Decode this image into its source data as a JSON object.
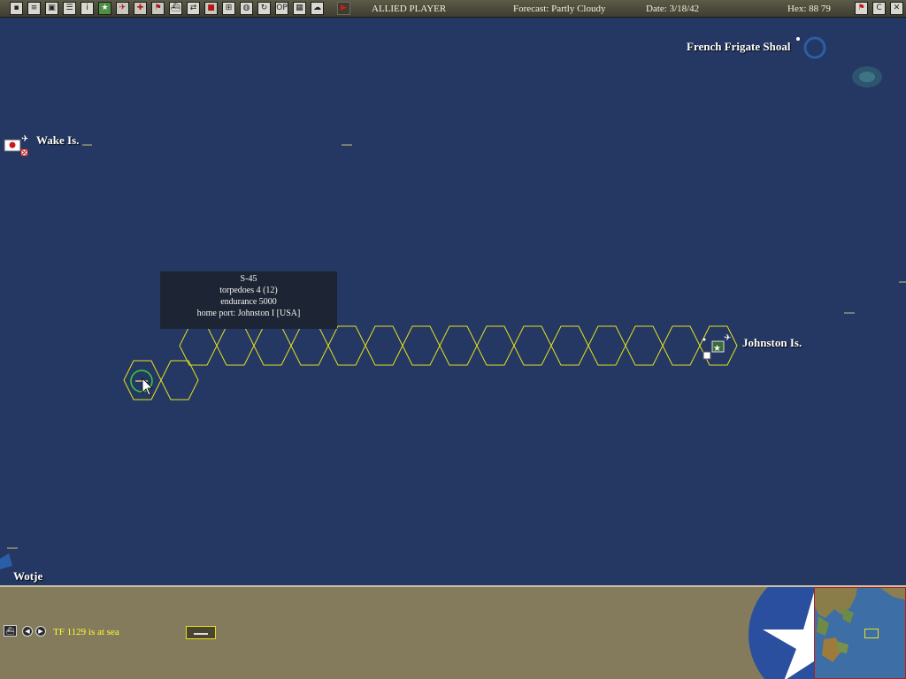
{
  "topbar": {
    "player": "ALLIED PLAYER",
    "forecast": "Forecast: Partly Cloudy",
    "date": "Date: 3/18/42",
    "hex": "Hex: 88 79",
    "right_buttons": [
      "flag-icon",
      "C",
      "close-icon"
    ]
  },
  "map": {
    "places": {
      "french_frigate": "French Frigate Shoal",
      "wake": "Wake Is.",
      "johnston": "Johnston Is.",
      "wotje": "Wotje"
    }
  },
  "tooltip": {
    "name": "S-45",
    "torpedoes": "torpedoes 4 (12)",
    "endurance": "endurance 5000",
    "home_port": "home port: Johnston I [USA]"
  },
  "bottombar": {
    "status": "TF 1129 is at sea"
  },
  "colors": {
    "ocean": "#243863",
    "move_path": "#e6e21c",
    "status_text": "#ffff33",
    "panel": "#847b5c"
  }
}
